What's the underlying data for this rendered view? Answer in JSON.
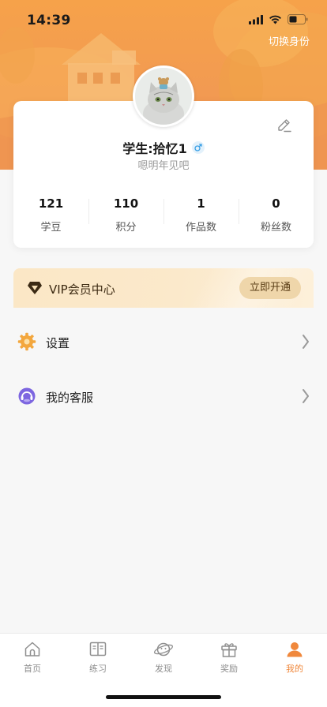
{
  "status_bar": {
    "time": "14:39"
  },
  "header": {
    "switch_identity_label": "切换身份"
  },
  "profile": {
    "name": "学生:拾忆1",
    "gender": "male",
    "signature": "嗯明年见吧",
    "stats": [
      {
        "value": "121",
        "label": "学豆"
      },
      {
        "value": "110",
        "label": "积分"
      },
      {
        "value": "1",
        "label": "作品数"
      },
      {
        "value": "0",
        "label": "粉丝数"
      }
    ]
  },
  "vip": {
    "title": "VIP会员中心",
    "button_label": "立即开通"
  },
  "menu": {
    "items": [
      {
        "label": "设置",
        "icon": "gear-icon"
      },
      {
        "label": "我的客服",
        "icon": "headset-icon"
      }
    ]
  },
  "tab_bar": {
    "tabs": [
      {
        "label": "首页",
        "icon": "home-icon"
      },
      {
        "label": "练习",
        "icon": "book-icon"
      },
      {
        "label": "发现",
        "icon": "planet-icon"
      },
      {
        "label": "奖励",
        "icon": "gift-icon"
      },
      {
        "label": "我的",
        "icon": "user-icon"
      }
    ],
    "active_index": 4
  },
  "colors": {
    "accent": "#f0883c",
    "header_bg": "#f29a52",
    "vip_bg": "#fbe7c6"
  }
}
